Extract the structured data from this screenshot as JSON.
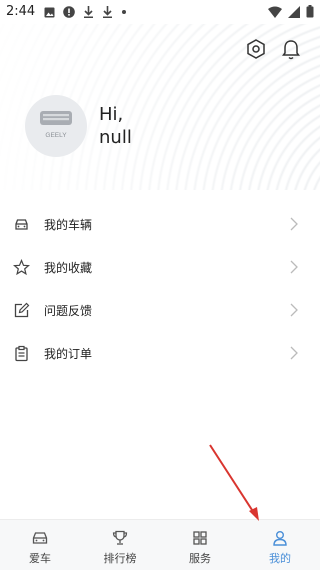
{
  "status_bar": {
    "time": "2:44"
  },
  "profile": {
    "greeting": "Hi,",
    "username": "null",
    "logo_text": "GEELY"
  },
  "menu": [
    {
      "label": "我的车辆",
      "icon": "car-icon"
    },
    {
      "label": "我的收藏",
      "icon": "star-icon"
    },
    {
      "label": "问题反馈",
      "icon": "edit-icon"
    },
    {
      "label": "我的订单",
      "icon": "clipboard-icon"
    }
  ],
  "bottom_nav": [
    {
      "label": "爱车",
      "icon": "car-icon",
      "active": false
    },
    {
      "label": "排行榜",
      "icon": "trophy-icon",
      "active": false
    },
    {
      "label": "服务",
      "icon": "grid-icon",
      "active": false
    },
    {
      "label": "我的",
      "icon": "person-icon",
      "active": true
    }
  ],
  "colors": {
    "accent": "#4a8fd8",
    "annotation_arrow": "#d9352f"
  }
}
